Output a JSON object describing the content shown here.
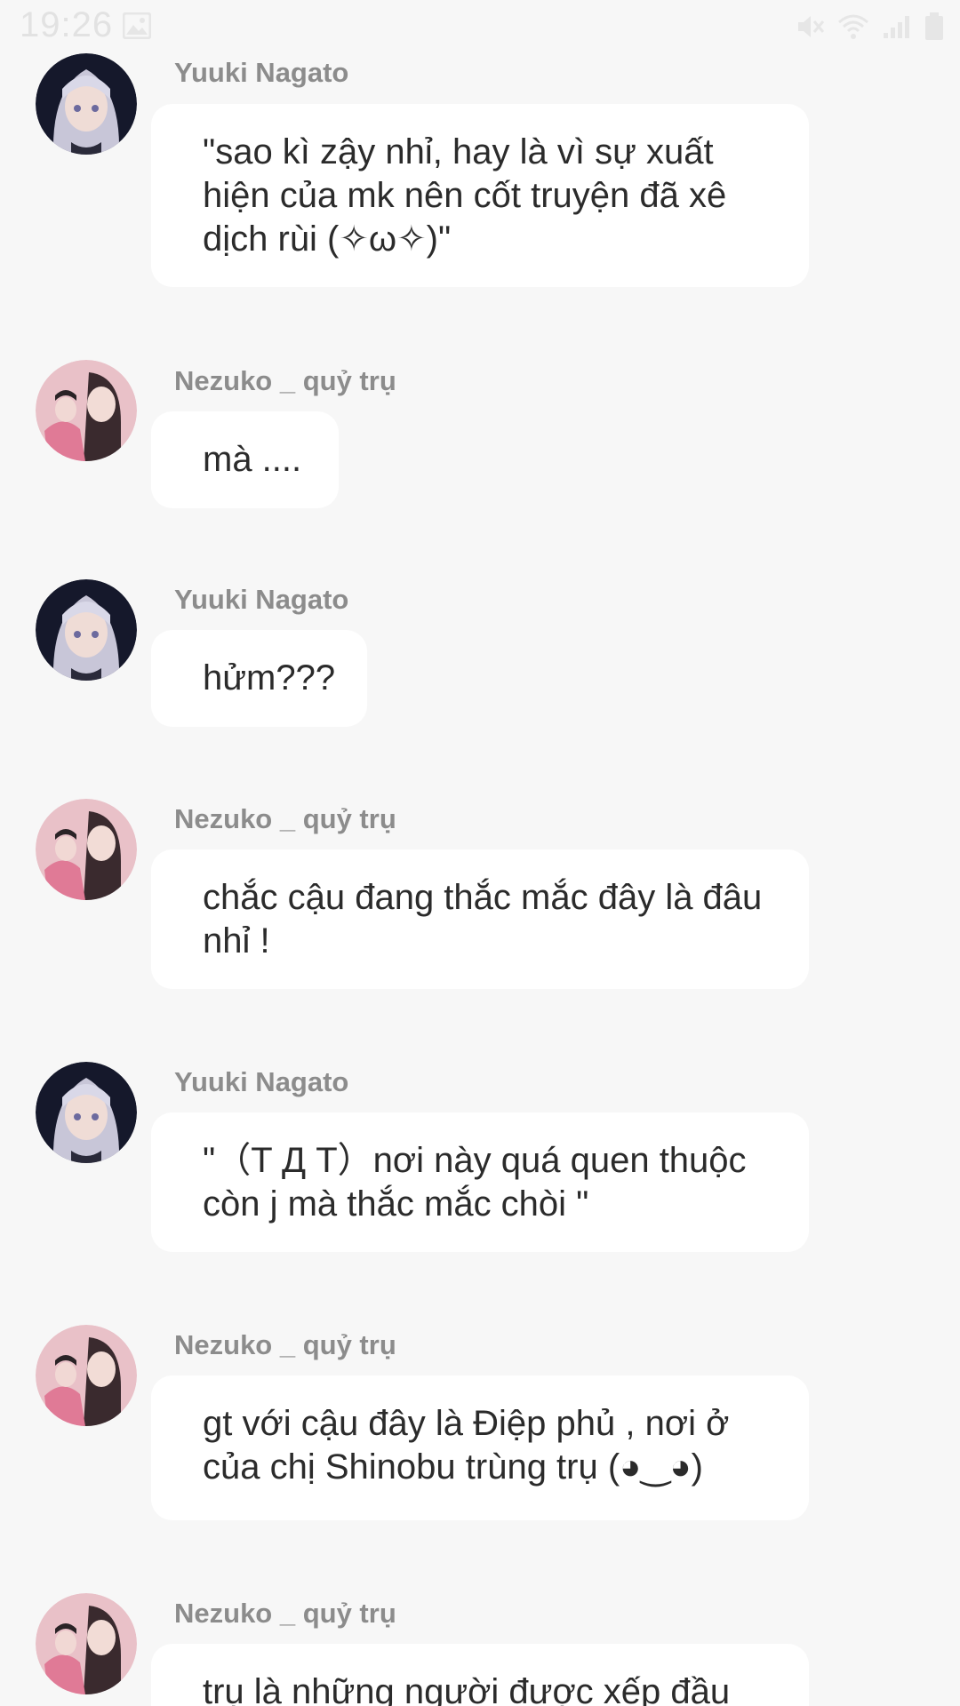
{
  "status_bar": {
    "time": "19:26",
    "icons": [
      "gallery-icon",
      "mute-icon",
      "wifi-icon",
      "signal-icon",
      "battery-icon"
    ]
  },
  "colors": {
    "background": "#f7f7f7",
    "bubble": "#ffffff",
    "sender_name": "#8c8c8c",
    "message_text": "#2b2b2b"
  },
  "messages": [
    {
      "sender": "Yuuki Nagato",
      "avatar": "yuuki-avatar",
      "text": "\"sao kì zậy nhỉ, hay là vì sự xuất hiện của mk nên cốt truyện đã xê dịch rùi (✧ω✧)\""
    },
    {
      "sender": "Nezuko _ quỷ trụ",
      "avatar": "nezuko-avatar",
      "text": "mà ...."
    },
    {
      "sender": "Yuuki Nagato",
      "avatar": "yuuki-avatar",
      "text": "hửm???"
    },
    {
      "sender": "Nezuko _ quỷ trụ",
      "avatar": "nezuko-avatar",
      "text": "chắc cậu đang thắc mắc đây là đâu nhỉ !"
    },
    {
      "sender": "Yuuki Nagato",
      "avatar": "yuuki-avatar",
      "text": "\"（T Д T）nơi này quá quen thuộc còn j mà thắc mắc chòi \""
    },
    {
      "sender": "Nezuko _ quỷ trụ",
      "avatar": "nezuko-avatar",
      "text": "gt với cậu đây là Điệp phủ , nơi ở của chị Shinobu trùng trụ (◕‿◕)"
    },
    {
      "sender": "Nezuko _ quỷ trụ",
      "avatar": "nezuko-avatar",
      "text": "trụ là những người được xếp đầu"
    }
  ]
}
